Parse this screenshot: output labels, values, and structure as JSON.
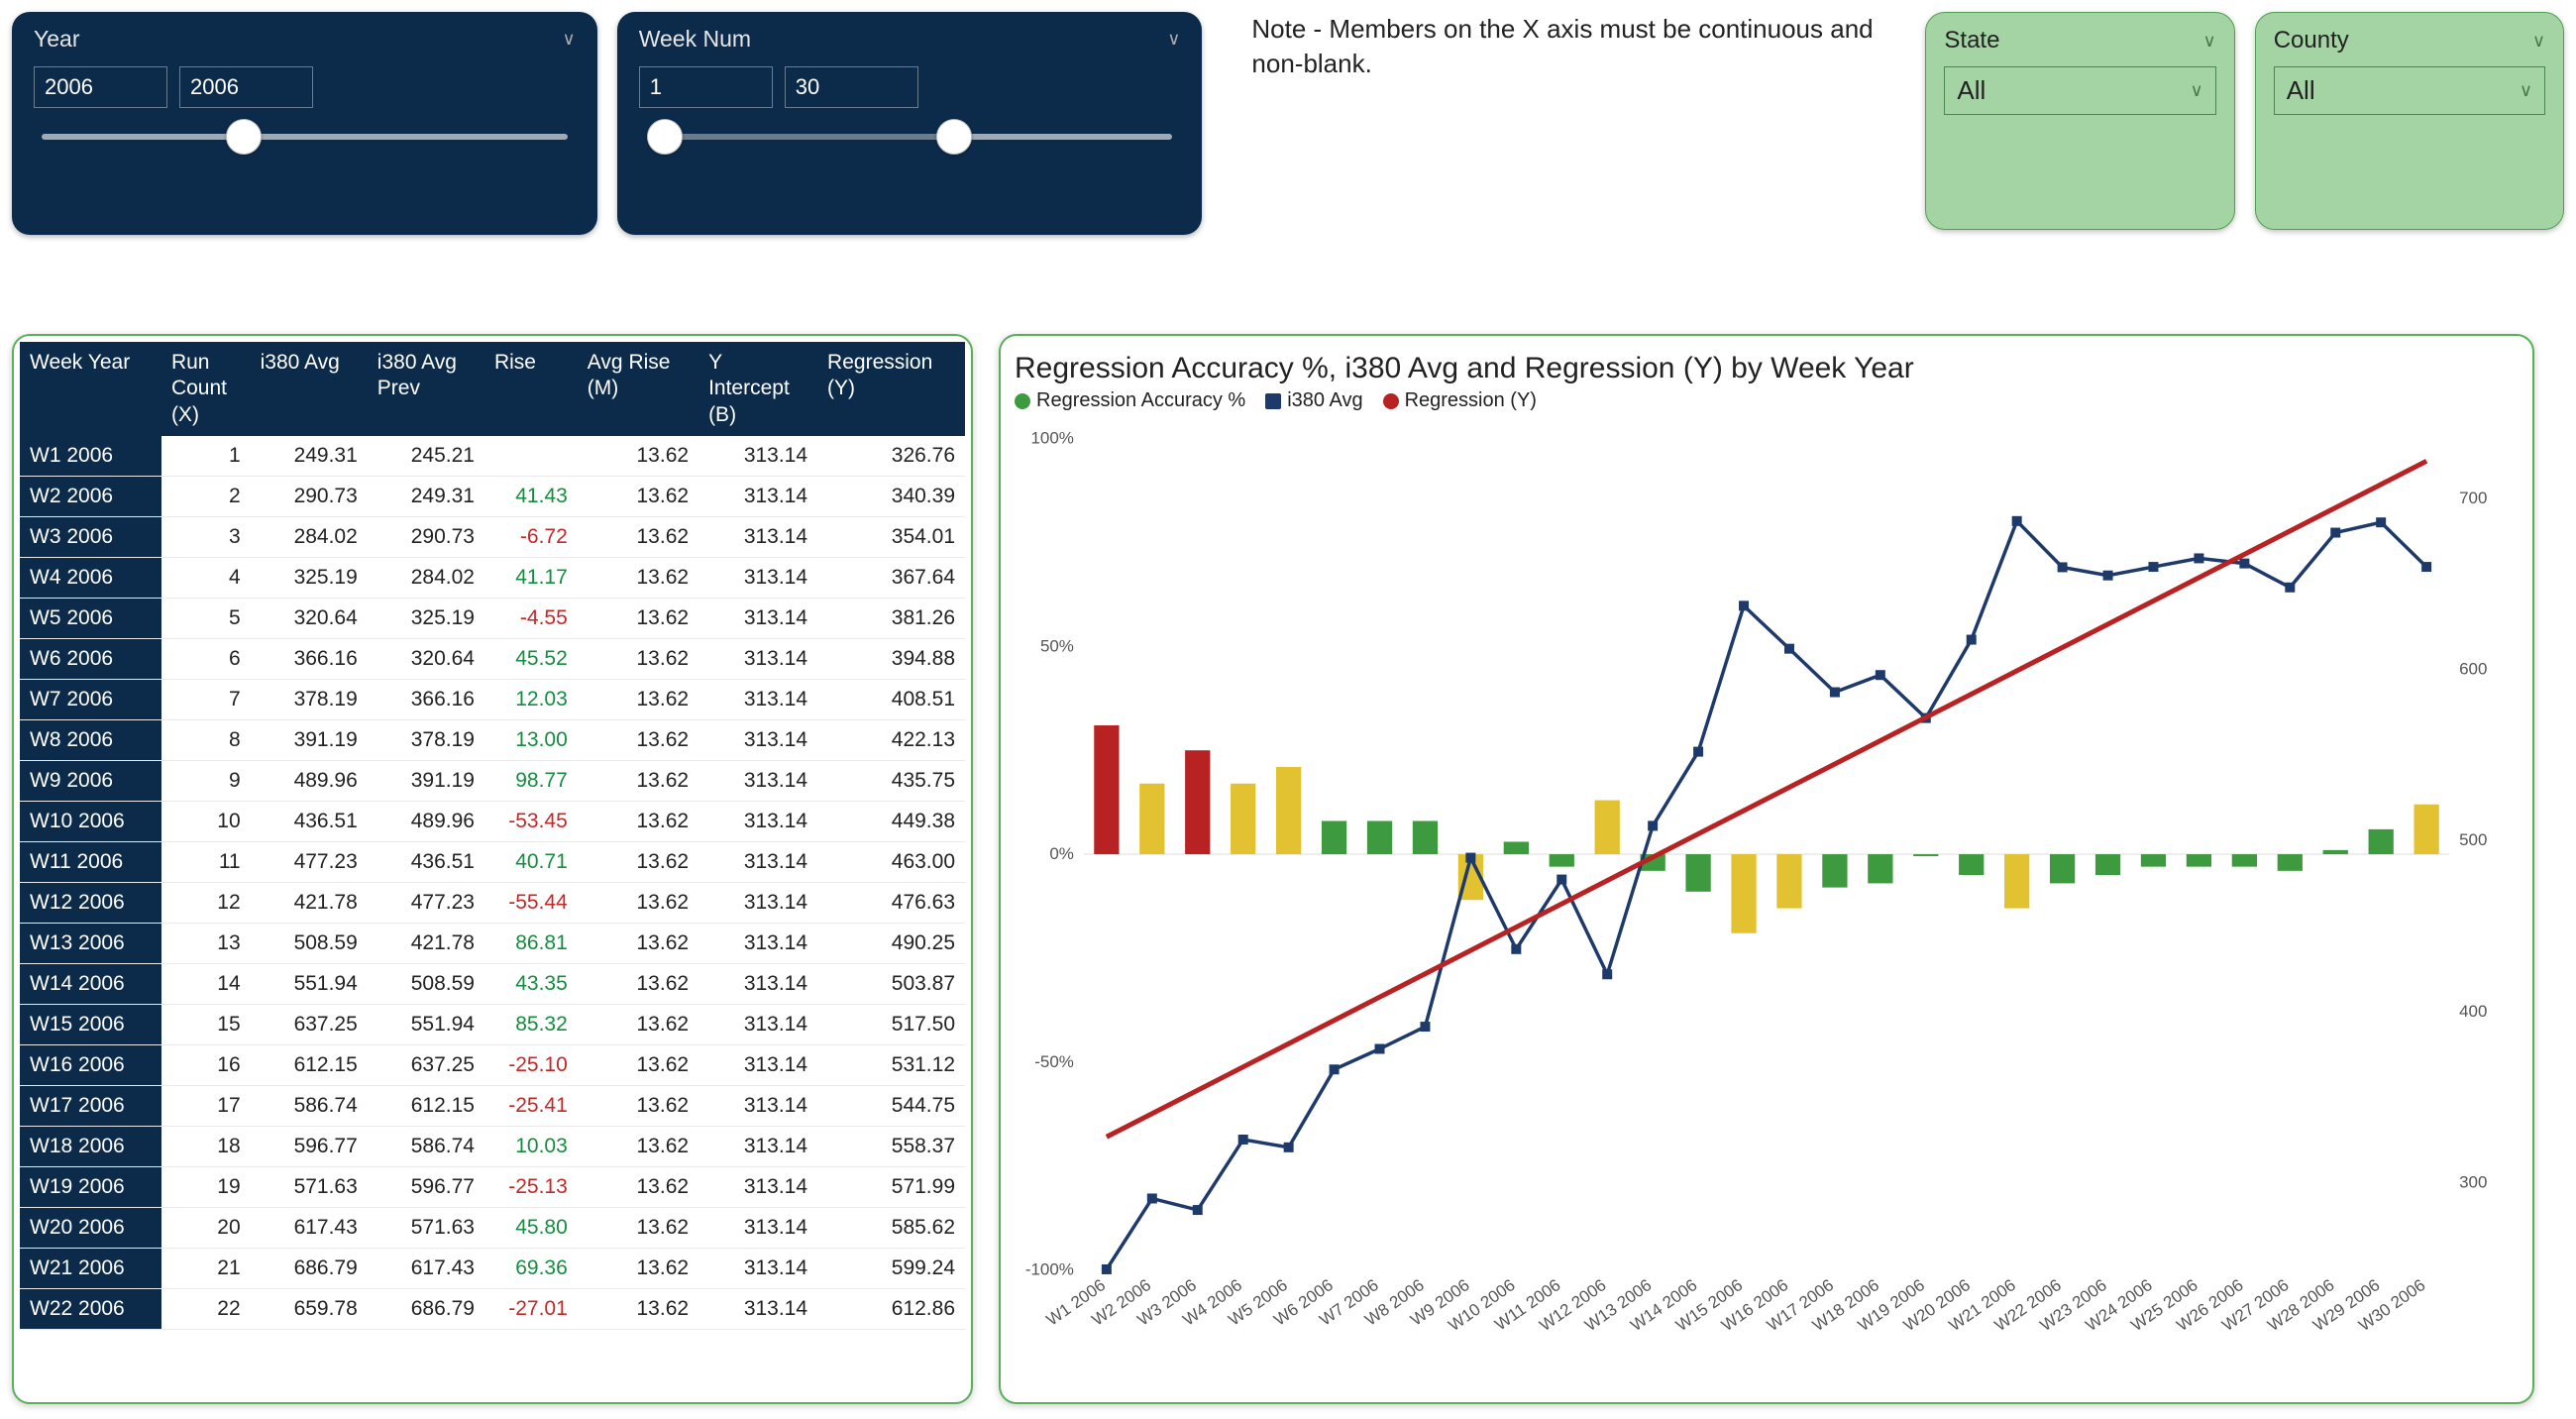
{
  "slicers": {
    "year": {
      "title": "Year",
      "from": "2006",
      "to": "2006",
      "thumb1_pct": 35,
      "thumb2_pct": 35
    },
    "week": {
      "title": "Week Num",
      "from": "1",
      "to": "30",
      "thumb1_pct": 0,
      "thumb2_pct": 55,
      "range_from_pct": 0,
      "range_to_pct": 55
    },
    "state": {
      "title": "State",
      "selected": "All"
    },
    "county": {
      "title": "County",
      "selected": "All"
    }
  },
  "note_text": "Note - Members on the X axis must be continuous and non-blank.",
  "table": {
    "columns": [
      "Week Year",
      "Run Count (X)",
      "i380 Avg",
      "i380 Avg Prev",
      "Rise",
      "Avg Rise (M)",
      "Y Intercept (B)",
      "Regression (Y)"
    ],
    "rows": [
      {
        "wy": "W1 2006",
        "x": 1,
        "avg": 249.31,
        "prev": 245.21,
        "rise": null,
        "m": 13.62,
        "b": 313.14,
        "y": 326.76
      },
      {
        "wy": "W2 2006",
        "x": 2,
        "avg": 290.73,
        "prev": 249.31,
        "rise": 41.43,
        "m": 13.62,
        "b": 313.14,
        "y": 340.39
      },
      {
        "wy": "W3 2006",
        "x": 3,
        "avg": 284.02,
        "prev": 290.73,
        "rise": -6.72,
        "m": 13.62,
        "b": 313.14,
        "y": 354.01
      },
      {
        "wy": "W4 2006",
        "x": 4,
        "avg": 325.19,
        "prev": 284.02,
        "rise": 41.17,
        "m": 13.62,
        "b": 313.14,
        "y": 367.64
      },
      {
        "wy": "W5 2006",
        "x": 5,
        "avg": 320.64,
        "prev": 325.19,
        "rise": -4.55,
        "m": 13.62,
        "b": 313.14,
        "y": 381.26
      },
      {
        "wy": "W6 2006",
        "x": 6,
        "avg": 366.16,
        "prev": 320.64,
        "rise": 45.52,
        "m": 13.62,
        "b": 313.14,
        "y": 394.88
      },
      {
        "wy": "W7 2006",
        "x": 7,
        "avg": 378.19,
        "prev": 366.16,
        "rise": 12.03,
        "m": 13.62,
        "b": 313.14,
        "y": 408.51
      },
      {
        "wy": "W8 2006",
        "x": 8,
        "avg": 391.19,
        "prev": 378.19,
        "rise": 13.0,
        "m": 13.62,
        "b": 313.14,
        "y": 422.13
      },
      {
        "wy": "W9 2006",
        "x": 9,
        "avg": 489.96,
        "prev": 391.19,
        "rise": 98.77,
        "m": 13.62,
        "b": 313.14,
        "y": 435.75
      },
      {
        "wy": "W10 2006",
        "x": 10,
        "avg": 436.51,
        "prev": 489.96,
        "rise": -53.45,
        "m": 13.62,
        "b": 313.14,
        "y": 449.38
      },
      {
        "wy": "W11 2006",
        "x": 11,
        "avg": 477.23,
        "prev": 436.51,
        "rise": 40.71,
        "m": 13.62,
        "b": 313.14,
        "y": 463.0
      },
      {
        "wy": "W12 2006",
        "x": 12,
        "avg": 421.78,
        "prev": 477.23,
        "rise": -55.44,
        "m": 13.62,
        "b": 313.14,
        "y": 476.63
      },
      {
        "wy": "W13 2006",
        "x": 13,
        "avg": 508.59,
        "prev": 421.78,
        "rise": 86.81,
        "m": 13.62,
        "b": 313.14,
        "y": 490.25
      },
      {
        "wy": "W14 2006",
        "x": 14,
        "avg": 551.94,
        "prev": 508.59,
        "rise": 43.35,
        "m": 13.62,
        "b": 313.14,
        "y": 503.87
      },
      {
        "wy": "W15 2006",
        "x": 15,
        "avg": 637.25,
        "prev": 551.94,
        "rise": 85.32,
        "m": 13.62,
        "b": 313.14,
        "y": 517.5
      },
      {
        "wy": "W16 2006",
        "x": 16,
        "avg": 612.15,
        "prev": 637.25,
        "rise": -25.1,
        "m": 13.62,
        "b": 313.14,
        "y": 531.12
      },
      {
        "wy": "W17 2006",
        "x": 17,
        "avg": 586.74,
        "prev": 612.15,
        "rise": -25.41,
        "m": 13.62,
        "b": 313.14,
        "y": 544.75
      },
      {
        "wy": "W18 2006",
        "x": 18,
        "avg": 596.77,
        "prev": 586.74,
        "rise": 10.03,
        "m": 13.62,
        "b": 313.14,
        "y": 558.37
      },
      {
        "wy": "W19 2006",
        "x": 19,
        "avg": 571.63,
        "prev": 596.77,
        "rise": -25.13,
        "m": 13.62,
        "b": 313.14,
        "y": 571.99
      },
      {
        "wy": "W20 2006",
        "x": 20,
        "avg": 617.43,
        "prev": 571.63,
        "rise": 45.8,
        "m": 13.62,
        "b": 313.14,
        "y": 585.62
      },
      {
        "wy": "W21 2006",
        "x": 21,
        "avg": 686.79,
        "prev": 617.43,
        "rise": 69.36,
        "m": 13.62,
        "b": 313.14,
        "y": 599.24
      },
      {
        "wy": "W22 2006",
        "x": 22,
        "avg": 659.78,
        "prev": 686.79,
        "rise": -27.01,
        "m": 13.62,
        "b": 313.14,
        "y": 612.86
      }
    ]
  },
  "chart_data": {
    "type": "combo",
    "title": "Regression Accuracy %, i380 Avg and Regression (Y) by Week Year",
    "legend": [
      {
        "name": "Regression Accuracy %",
        "color": "#3e9a3e",
        "shape": "circle"
      },
      {
        "name": "i380 Avg",
        "color": "#1d3a6b",
        "shape": "square"
      },
      {
        "name": "Regression (Y)",
        "color": "#b82222",
        "shape": "circle"
      }
    ],
    "categories": [
      "W1 2006",
      "W2 2006",
      "W3 2006",
      "W4 2006",
      "W5 2006",
      "W6 2006",
      "W7 2006",
      "W8 2006",
      "W9 2006",
      "W10 2006",
      "W11 2006",
      "W12 2006",
      "W13 2006",
      "W14 2006",
      "W15 2006",
      "W16 2006",
      "W17 2006",
      "W18 2006",
      "W19 2006",
      "W20 2006",
      "W21 2006",
      "W22 2006",
      "W23 2006",
      "W24 2006",
      "W25 2006",
      "W26 2006",
      "W27 2006",
      "W28 2006",
      "W29 2006",
      "W30 2006"
    ],
    "y1": {
      "label": "",
      "min": -100,
      "max": 100,
      "unit": "%",
      "ticks": [
        -100,
        -50,
        0,
        50,
        100
      ]
    },
    "y2": {
      "label": "",
      "min": 249,
      "max": 735,
      "ticks": [
        300,
        400,
        500,
        600,
        700
      ]
    },
    "series": [
      {
        "name": "Regression Accuracy %",
        "type": "bar",
        "axis": "y1",
        "values": [
          31,
          17,
          25,
          17,
          21,
          8,
          8,
          8,
          -11,
          3,
          -3,
          13,
          -4,
          -9,
          -19,
          -13,
          -8,
          -7,
          0,
          -5,
          -13,
          -7,
          -5,
          -3,
          -3,
          -3,
          -4,
          1,
          6,
          12
        ],
        "colors": [
          "#b82222",
          "#e2c231",
          "#b82222",
          "#e2c231",
          "#e2c231",
          "#3e9a3e",
          "#3e9a3e",
          "#3e9a3e",
          "#e2c231",
          "#3e9a3e",
          "#3e9a3e",
          "#e2c231",
          "#3e9a3e",
          "#3e9a3e",
          "#e2c231",
          "#e2c231",
          "#3e9a3e",
          "#3e9a3e",
          "#3e9a3e",
          "#3e9a3e",
          "#e2c231",
          "#3e9a3e",
          "#3e9a3e",
          "#3e9a3e",
          "#3e9a3e",
          "#3e9a3e",
          "#3e9a3e",
          "#3e9a3e",
          "#3e9a3e",
          "#e2c231"
        ]
      },
      {
        "name": "i380 Avg",
        "type": "line",
        "axis": "y2",
        "values": [
          249.31,
          290.73,
          284.02,
          325.19,
          320.64,
          366.16,
          378.19,
          391.19,
          489.96,
          436.51,
          477.23,
          421.78,
          508.59,
          551.94,
          637.25,
          612.15,
          586.74,
          596.77,
          571.63,
          617.43,
          686.79,
          659.78,
          655,
          660,
          665,
          662,
          648,
          680,
          686,
          660
        ]
      },
      {
        "name": "Regression (Y)",
        "type": "line",
        "axis": "y2",
        "values": [
          326.76,
          340.39,
          354.01,
          367.64,
          381.26,
          394.88,
          408.51,
          422.13,
          435.75,
          449.38,
          463.0,
          476.63,
          490.25,
          503.87,
          517.5,
          531.12,
          544.75,
          558.37,
          571.99,
          585.62,
          599.24,
          612.86,
          626.49,
          640.11,
          653.73,
          667.36,
          680.98,
          694.6,
          708.23,
          721.85
        ]
      }
    ]
  },
  "colors": {
    "navy": "#0c2b4a",
    "green_border": "#58b158",
    "green_fill": "#a4d4a4"
  }
}
